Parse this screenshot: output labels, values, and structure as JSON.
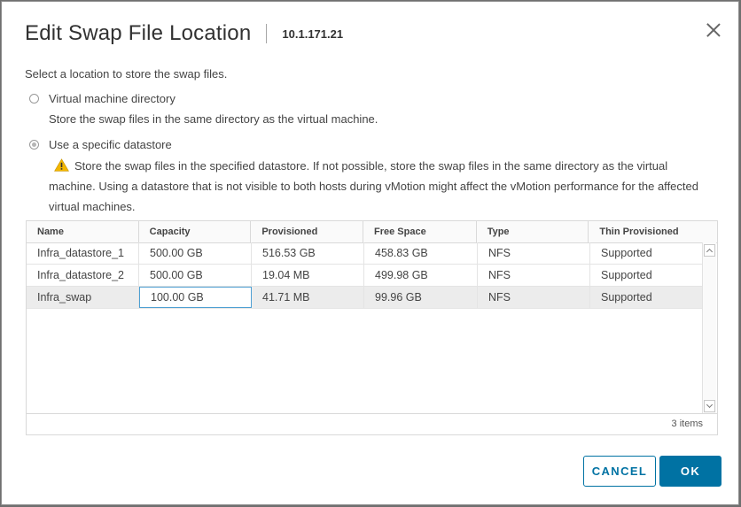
{
  "dialog": {
    "title": "Edit Swap File Location",
    "host": "10.1.171.21",
    "close_icon": "close-icon",
    "prompt": "Select a location to store the swap files."
  },
  "options": [
    {
      "label": "Virtual machine directory",
      "description": "Store the swap files in the same directory as the virtual machine.",
      "checked": false
    },
    {
      "label": "Use a specific datastore",
      "description": "Store the swap files in the specified datastore. If not possible, store the swap files in the same directory as the virtual machine. Using a datastore that is not visible to both hosts during vMotion might affect the vMotion performance for the affected virtual machines.",
      "checked": true,
      "icon": "warning-icon"
    }
  ],
  "table": {
    "columns": [
      "Name",
      "Capacity",
      "Provisioned",
      "Free Space",
      "Type",
      "Thin Provisioned"
    ],
    "rows": [
      [
        "Infra_datastore_1",
        "500.00 GB",
        "516.53 GB",
        "458.83 GB",
        "NFS",
        "Supported"
      ],
      [
        "Infra_datastore_2",
        "500.00 GB",
        "19.04 MB",
        "499.98 GB",
        "NFS",
        "Supported"
      ],
      [
        "Infra_swap",
        "100.00 GB",
        "41.71 MB",
        "99.96 GB",
        "NFS",
        "Supported"
      ]
    ],
    "selected_row": "Infra_swap",
    "footer": "3 items"
  },
  "buttons": {
    "cancel": "CANCEL",
    "ok": "OK"
  },
  "colors": {
    "primary": "#0072a3",
    "selection": "#ececec",
    "warning": "#f2b600"
  }
}
